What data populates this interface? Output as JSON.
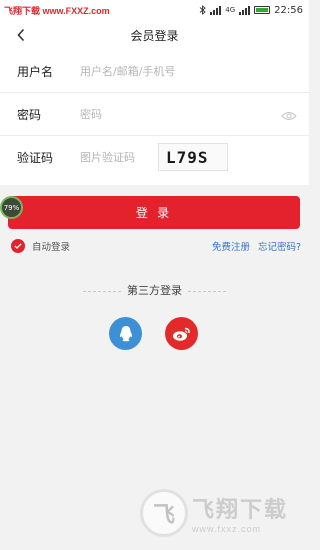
{
  "status_bar": {
    "watermark": "飞翔下载 www.FXXZ.com",
    "network": "4G",
    "time": "22:56"
  },
  "header": {
    "title": "会员登录",
    "back_icon": "chevron-left-icon"
  },
  "form": {
    "username": {
      "label": "用户名",
      "placeholder": "用户名/邮箱/手机号",
      "value": ""
    },
    "password": {
      "label": "密码",
      "placeholder": "密码",
      "value": ""
    },
    "captcha": {
      "label": "验证码",
      "placeholder": "图片验证码",
      "value": "",
      "image_text": "L79S"
    }
  },
  "login_button": {
    "label": "登 录"
  },
  "progress_badge": {
    "text": "79%"
  },
  "options": {
    "auto_login": {
      "label": "自动登录",
      "checked": true
    },
    "register_link": "免费注册",
    "forgot_link": "忘记密码?"
  },
  "third_party": {
    "title": "第三方登录",
    "providers": [
      {
        "name": "qq",
        "icon": "qq-icon",
        "color": "#3d8fd6"
      },
      {
        "name": "weibo",
        "icon": "weibo-icon",
        "color": "#e32a2a"
      }
    ]
  },
  "watermark_bottom": {
    "logo": "飞",
    "title": "飞翔下载",
    "url": "www.fxxz.com"
  },
  "colors": {
    "accent": "#e3222d",
    "link": "#3a72c4",
    "background": "#f2f2f2"
  }
}
